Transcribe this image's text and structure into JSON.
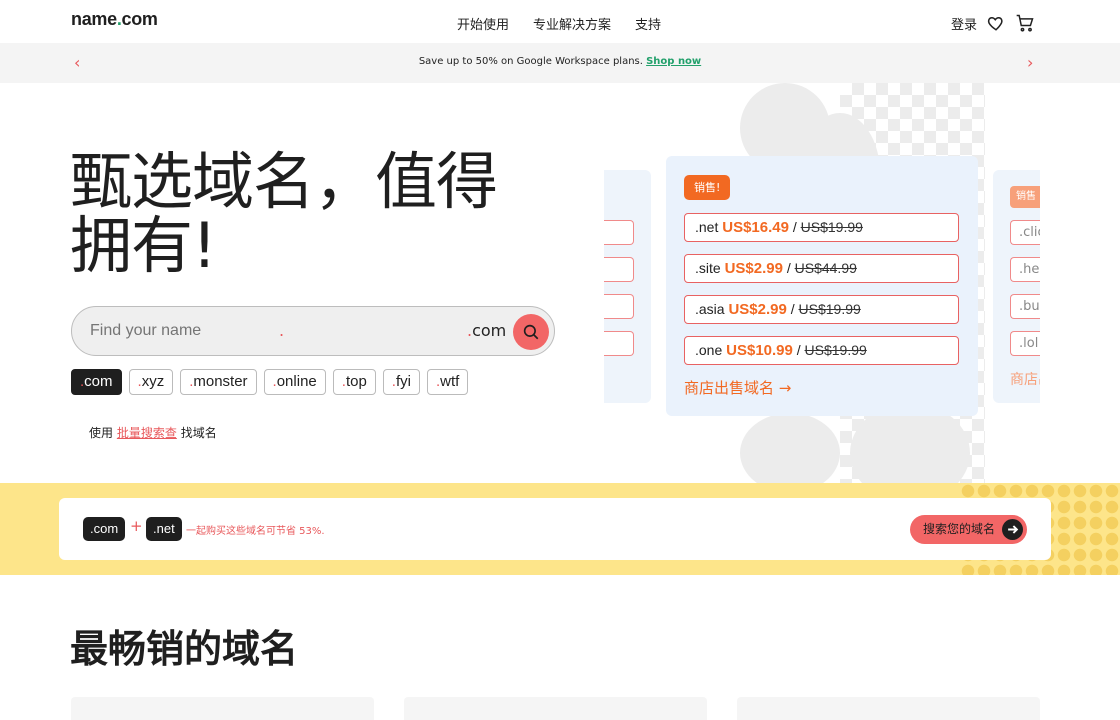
{
  "header": {
    "logo_main": "name",
    "logo_dot": ".",
    "logo_tld": "com",
    "nav": [
      "开始使用",
      "专业解决方案",
      "支持"
    ],
    "login": "登录",
    "wishlist_icon": "heart-icon",
    "cart_icon": "cart-icon"
  },
  "promo": {
    "text": "Save up to 50% on Google Workspace plans.",
    "link": "Shop now",
    "prev_icon": "chevron-left-icon",
    "next_icon": "chevron-right-icon"
  },
  "hero": {
    "title": "甄选域名，值得拥有!",
    "search_placeholder": "Find your name",
    "search_tld": "com",
    "search_icon": "search-icon",
    "tlds": [
      "com",
      "xyz",
      "monster",
      "online",
      "top",
      "fyi",
      "wtf"
    ],
    "bulk_prefix": "使用",
    "bulk_link": "批量搜索查",
    "bulk_suffix": "找域名"
  },
  "sale_card": {
    "badge": "销售!",
    "rows": [
      {
        "tld": ".net",
        "price": "US$16.49",
        "sep": "/",
        "was": "US$19.99"
      },
      {
        "tld": ".site",
        "price": "US$2.99",
        "sep": "/",
        "was": "US$44.99"
      },
      {
        "tld": ".asia",
        "price": "US$2.99",
        "sep": "/",
        "was": "US$19.99"
      },
      {
        "tld": ".one",
        "price": "US$10.99",
        "sep": "/",
        "was": "US$19.99"
      }
    ],
    "link": "商店出售域名",
    "link_icon": "arrow-right-icon"
  },
  "side_card": {
    "badge": "销售",
    "rows": [
      ".clic",
      ".hel",
      ".buz",
      ".lol"
    ],
    "link": "商店出"
  },
  "bundle": {
    "tld_a": ".com",
    "plus": "+",
    "tld_b": ".net",
    "savings": "一起购买这些域名可节省 53%.",
    "cta": "搜索您的域名",
    "cta_icon": "arrow-right-icon"
  },
  "best": {
    "title": "最畅销的域名"
  },
  "colors": {
    "accent": "#e8585b",
    "orange": "#f26922",
    "green": "#22a06b",
    "band": "#fde58a",
    "card": "#eaf2fc"
  }
}
